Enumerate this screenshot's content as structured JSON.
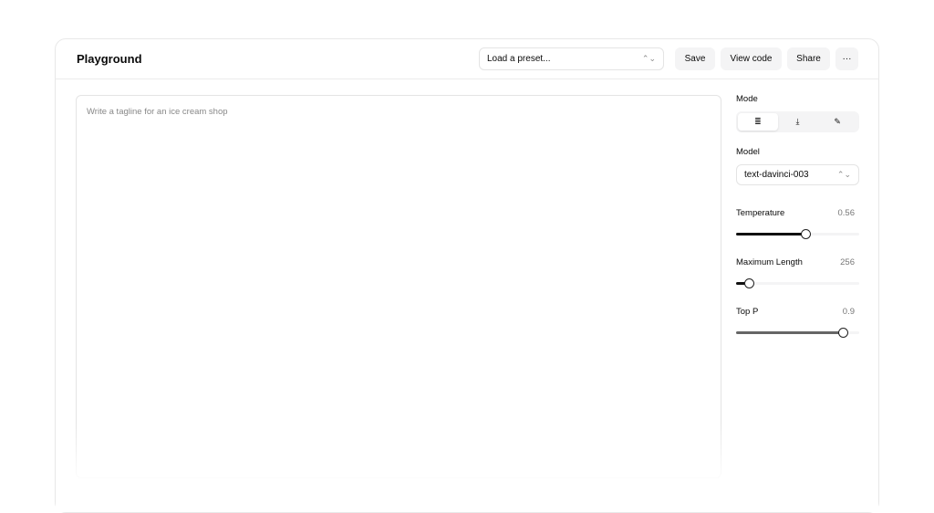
{
  "header": {
    "title": "Playground",
    "preset_placeholder": "Load a preset...",
    "save": "Save",
    "view_code": "View code",
    "share": "Share",
    "more": "···"
  },
  "editor": {
    "placeholder": "Write a tagline for an ice cream shop"
  },
  "sidebar": {
    "mode_label": "Mode",
    "modes": [
      {
        "icon": "complete-icon",
        "glyph": "≣"
      },
      {
        "icon": "insert-icon",
        "glyph": "⤓"
      },
      {
        "icon": "edit-icon",
        "glyph": "✎"
      }
    ],
    "model_label": "Model",
    "model_value": "text-davinci-003",
    "sliders": [
      {
        "label": "Temperature",
        "value": "0.56",
        "fraction": 0.56
      },
      {
        "label": "Maximum Length",
        "value": "256",
        "fraction": 0.1
      },
      {
        "label": "Top P",
        "value": "0.9",
        "fraction": 0.87
      }
    ]
  }
}
